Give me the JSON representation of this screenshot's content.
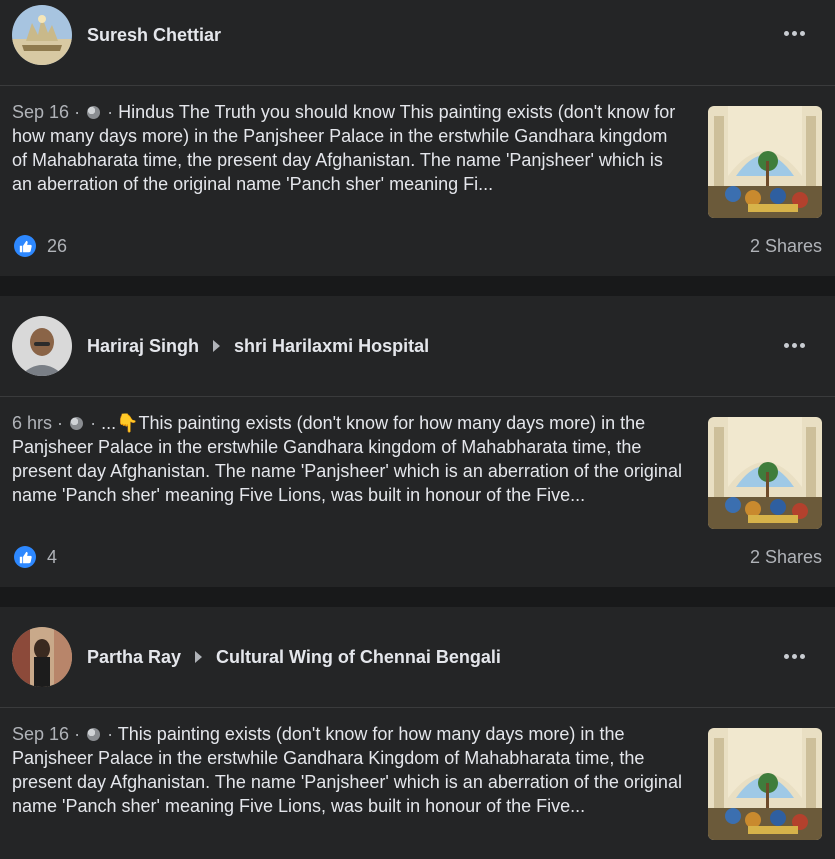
{
  "posts": [
    {
      "author": "Suresh Chettiar",
      "group": "",
      "timestamp": "Sep 16",
      "text": "Hindus The Truth you should know This painting exists (don't know for how many days more) in the Panjsheer Palace in the erstwhile Gandhara kingdom of Mahabharata time, the present day Afghanistan. The name 'Panjsheer' which is an aberration of the original name 'Panch sher' meaning Fi...",
      "likes": "26",
      "shares": "2 Shares",
      "separator": "·"
    },
    {
      "author": "Hariraj Singh",
      "group": "shri Harilaxmi Hospital",
      "timestamp": "6 hrs",
      "text": "...👇This painting exists (don't know for how many days more) in the Panjsheer Palace in the erstwhile Gandhara kingdom of Mahabharata time, the present day Afghanistan. The name 'Panjsheer' which is an aberration of the original name 'Panch sher' meaning Five Lions, was built in honour of the Five...",
      "likes": "4",
      "shares": "2 Shares",
      "separator": "·"
    },
    {
      "author": "Partha Ray",
      "group": "Cultural Wing of Chennai Bengali",
      "timestamp": "Sep 16",
      "text": "This painting exists (don't know for how many days more) in the Panjsheer Palace in the erstwhile Gandhara Kingdom of Mahabharata time, the present day Afghanistan. The name 'Panjsheer' which is an aberration of the original name 'Panch sher' meaning Five Lions, was built in honour of the Five...",
      "likes": "",
      "shares": "",
      "separator": "·"
    }
  ],
  "colors": {
    "background": "#18191a",
    "card": "#242526",
    "text": "#e4e6eb",
    "secondary_text": "#b0b3b8",
    "like_blue": "#2d88ff"
  },
  "icons": [
    "globe-icon",
    "more-options-icon",
    "like-icon",
    "arrow-right-icon",
    "thumbnail-painting"
  ]
}
